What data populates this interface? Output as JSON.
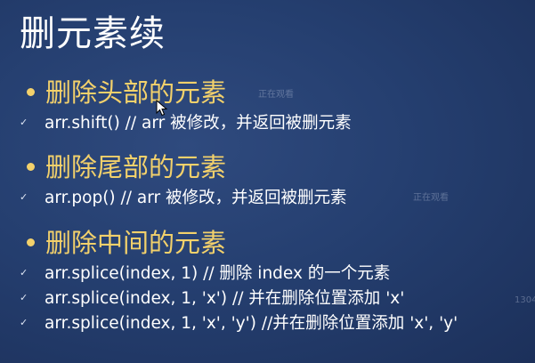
{
  "slide": {
    "title": "删元素续",
    "sections": [
      {
        "heading": "删除头部的元素",
        "items": [
          "arr.shift() // arr 被修改，并返回被删元素"
        ]
      },
      {
        "heading": "删除尾部的元素",
        "items": [
          "arr.pop() // arr 被修改，并返回被删元素"
        ]
      },
      {
        "heading": "删除中间的元素",
        "items": [
          "arr.splice(index, 1) // 删除 index 的一个元素",
          "arr.splice(index, 1, 'x') // 并在删除位置添加 'x'",
          "arr.splice(index, 1, 'x', 'y') //并在删除位置添加 'x', 'y'"
        ]
      }
    ]
  },
  "overlay": {
    "watermark_1": "正在观看",
    "watermark_2": "正在观看",
    "watermark_3": "1304"
  },
  "icons": {
    "check": "✓",
    "cursor": "mouse-cursor-icon"
  },
  "colors": {
    "background": "#253f70",
    "heading": "#f3d16b",
    "text": "#ffffff"
  }
}
